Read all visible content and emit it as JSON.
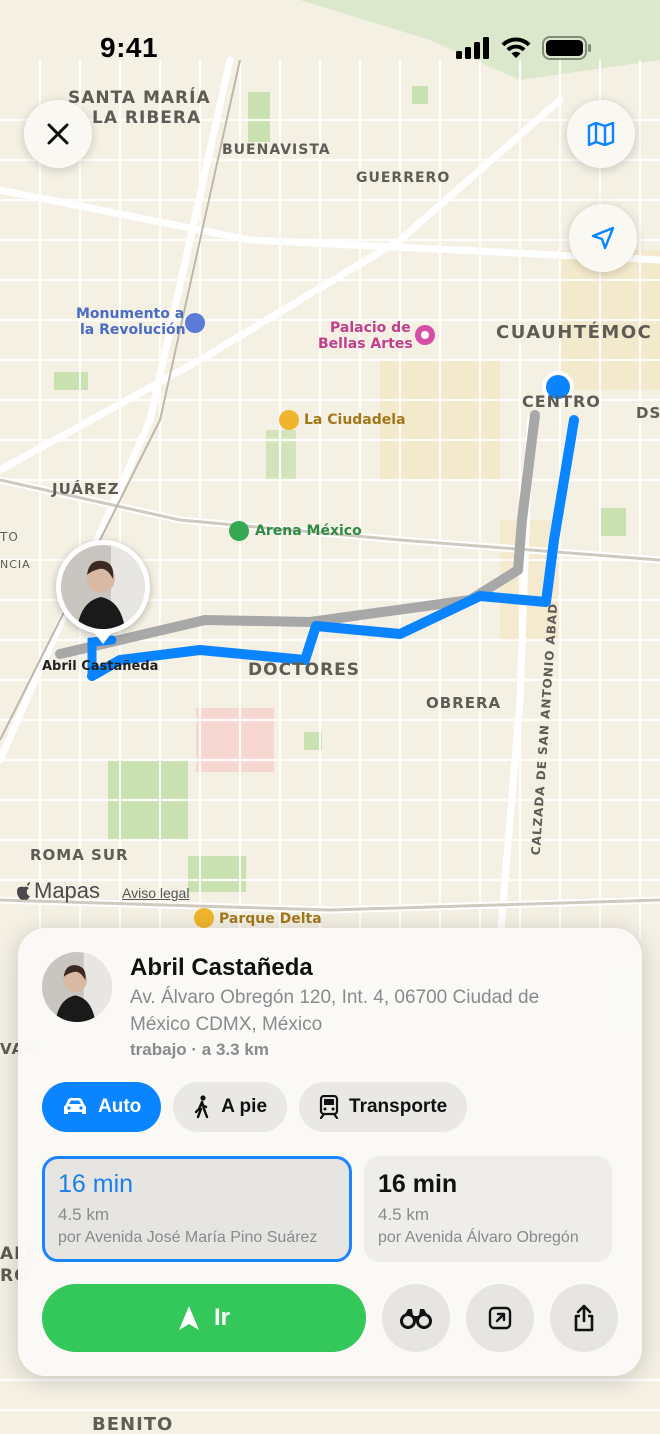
{
  "status_bar": {
    "time": "9:41"
  },
  "map": {
    "districts": {
      "santa_maria_1": "SANTA MARÍA",
      "santa_maria_2": "LA RIBERA",
      "buenavista": "BUENAVISTA",
      "guerrero": "GUERRERO",
      "cuauhtemoc": "CUAUHTÉMOC",
      "centro": "CENTRO",
      "juarez": "JUÁREZ",
      "doctores": "DOCTORES",
      "obrera": "OBRERA",
      "roma_sur": "ROMA SUR",
      "benito": "BENITO",
      "calzada": "CALZADA DE SAN ANTONIO ABAD",
      "edge_to": "TO",
      "edge_ncia": "NCIA",
      "edge_ds": "DS",
      "edge_var": "VAR",
      "edge_all": "ALL",
      "edge_ro": "RO"
    },
    "pois": {
      "monumento_1": "Monumento a",
      "monumento_2": "la Revolución",
      "bellas_1": "Palacio de",
      "bellas_2": "Bellas Artes",
      "ciudadela": "La Ciudadela",
      "arena": "Arena México",
      "parque": "Parque Delta"
    },
    "destination_label": "Abril Castañeda",
    "brand": "Mapas",
    "legal": "Aviso legal"
  },
  "card": {
    "name": "Abril Castañeda",
    "address": "Av. Álvaro Obregón 120, Int. 4, 06700 Ciudad de México CDMX, México",
    "meta": "trabajo · a 3.3 km",
    "modes": [
      {
        "label": "Auto",
        "icon": "car-icon",
        "active": true
      },
      {
        "label": "A pie",
        "icon": "walking-icon",
        "active": false
      },
      {
        "label": "Transporte",
        "icon": "tram-icon",
        "active": false
      }
    ],
    "routes": [
      {
        "time": "16 min",
        "distance": "4.5 km",
        "via": "por Avenida José María Pino Suárez",
        "selected": true
      },
      {
        "time": "16 min",
        "distance": "4.5 km",
        "via": "por Avenida Álvaro Obregón",
        "selected": false
      }
    ],
    "go_label": "Ir"
  },
  "colors": {
    "route_primary": "#0a84ff",
    "route_alt": "#a8a8a8",
    "go_green": "#34c759",
    "map_bg": "#f3efe3"
  }
}
